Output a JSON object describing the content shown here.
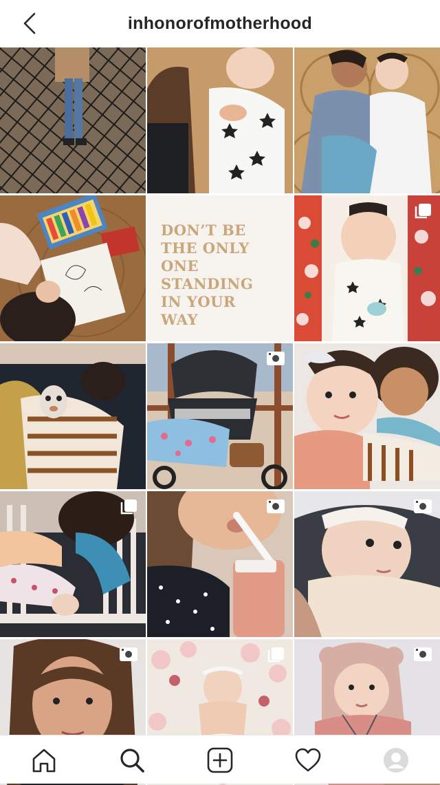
{
  "header": {
    "title": "inhonorofmotherhood",
    "back_icon": "chevron-left-icon"
  },
  "grid": {
    "tiles": [
      {
        "name": "post-fence-child",
        "badge": ""
      },
      {
        "name": "post-mother-baby-stars",
        "badge": ""
      },
      {
        "name": "post-siblings-rattan",
        "badge": ""
      },
      {
        "name": "post-coloring-book",
        "badge": ""
      },
      {
        "name": "post-quote",
        "badge": ""
      },
      {
        "name": "post-baby-floral",
        "badge": "carousel"
      },
      {
        "name": "post-baby-stripes-sleeping",
        "badge": ""
      },
      {
        "name": "post-stroller",
        "badge": "video"
      },
      {
        "name": "post-siblings-hug",
        "badge": ""
      },
      {
        "name": "post-crib-play",
        "badge": "carousel"
      },
      {
        "name": "post-mother-bottle",
        "badge": "video"
      },
      {
        "name": "post-baby-headband",
        "badge": "video"
      },
      {
        "name": "post-mother-selfie",
        "badge": "video"
      },
      {
        "name": "post-baby-flowers",
        "badge": "carousel"
      },
      {
        "name": "post-baby-bear-hat",
        "badge": "video"
      }
    ],
    "quote_text": "DON’T BE\nTHE ONLY\nONE\nSTANDING\nIN YOUR\nWAY"
  },
  "nav": {
    "items": [
      "home-icon",
      "search-icon",
      "new-post-icon",
      "heart-icon",
      "profile-avatar-icon"
    ]
  },
  "colors": {
    "quote_bg": "#f6f3ef",
    "quote_text": "#c9a77b",
    "text": "#262626"
  }
}
